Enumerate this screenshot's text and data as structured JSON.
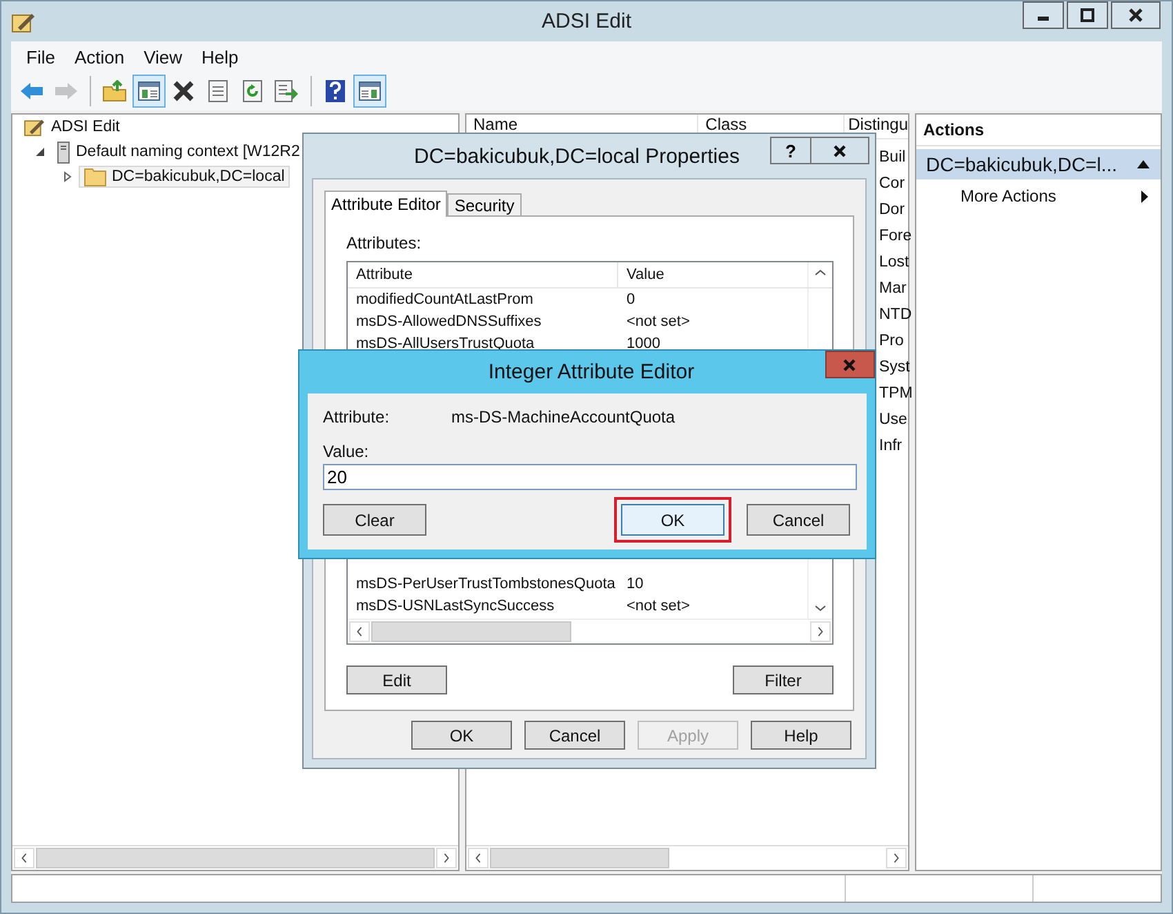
{
  "window": {
    "title": "ADSI Edit"
  },
  "menu": [
    "File",
    "Action",
    "View",
    "Help"
  ],
  "toolbar": [
    {
      "kind": "back",
      "disabled": false,
      "pressed": false
    },
    {
      "kind": "forward",
      "disabled": true,
      "pressed": false
    },
    {
      "kind": "up",
      "disabled": false,
      "pressed": false
    },
    {
      "kind": "tree",
      "disabled": false,
      "pressed": true
    },
    {
      "kind": "delete",
      "disabled": false,
      "pressed": false
    },
    {
      "kind": "properties",
      "disabled": false,
      "pressed": false
    },
    {
      "kind": "refresh",
      "disabled": false,
      "pressed": false
    },
    {
      "kind": "export",
      "disabled": false,
      "pressed": false
    },
    {
      "kind": "help",
      "disabled": false,
      "pressed": false
    },
    {
      "kind": "pane",
      "disabled": false,
      "pressed": true
    }
  ],
  "tree": [
    {
      "label": "ADSI Edit",
      "kind": "root",
      "selected": false,
      "children": [
        {
          "label": "Default naming context [W12R2",
          "kind": "server",
          "expanded": true,
          "selected": false,
          "children": [
            {
              "label": "DC=bakicubuk,DC=local",
              "kind": "folder",
              "expanded": false,
              "selected": true
            }
          ]
        }
      ]
    }
  ],
  "list": {
    "columns": [
      "Name",
      "Class",
      "Distingu"
    ],
    "column_3_fragments": [
      "Buil",
      "Cor",
      "Dor",
      "Fore",
      "Lost",
      "Mar",
      "NTD",
      "Pro",
      "Syst",
      "TPM",
      "Use",
      "Infr"
    ]
  },
  "actions": {
    "title": "Actions",
    "section": {
      "label": "DC=bakicubuk,DC=l...",
      "expanded": true
    },
    "items": [
      "More Actions"
    ]
  },
  "properties": {
    "title": "DC=bakicubuk,DC=local Properties",
    "help_button": "?",
    "tabs": [
      {
        "label": "Attribute Editor",
        "selected": true
      },
      {
        "label": "Security",
        "selected": false
      }
    ],
    "attributes_label": "Attributes:",
    "columns": [
      "Attribute",
      "Value"
    ],
    "rows": [
      {
        "attribute": "modifiedCountAtLastProm",
        "value": "0"
      },
      {
        "attribute": "msDS-AllowedDNSSuffixes",
        "value": "<not set>"
      },
      {
        "attribute": "msDS-AllUsersTrustQuota",
        "value": "1000"
      },
      {
        "attribute": "msDS-PerUserTrustTombstonesQuota",
        "value": "10"
      },
      {
        "attribute": "msDS-USNLastSyncSuccess",
        "value": "<not set>"
      }
    ],
    "list_buttons": [
      "Edit",
      "Filter"
    ],
    "buttons": [
      {
        "label": "OK",
        "disabled": false
      },
      {
        "label": "Cancel",
        "disabled": false
      },
      {
        "label": "Apply",
        "disabled": true
      },
      {
        "label": "Help",
        "disabled": false
      }
    ]
  },
  "editor": {
    "title": "Integer Attribute Editor",
    "attribute_label": "Attribute:",
    "attribute_value": "ms-DS-MachineAccountQuota",
    "value_label": "Value:",
    "value": "20",
    "buttons": [
      {
        "label": "Clear",
        "highlighted": false
      },
      {
        "label": "OK",
        "highlighted": true
      },
      {
        "label": "Cancel",
        "highlighted": false
      }
    ]
  }
}
